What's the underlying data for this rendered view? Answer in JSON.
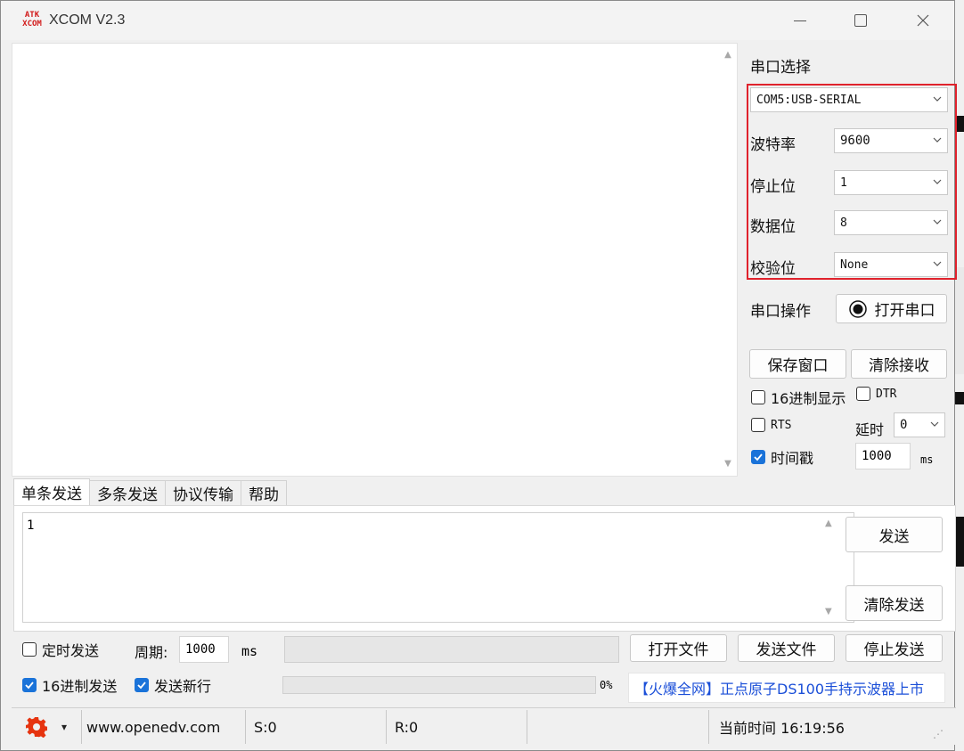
{
  "window": {
    "title": "XCOM V2.3",
    "logo_top": "ATK",
    "logo_bottom": "XCOM"
  },
  "right_panel": {
    "port_section_label": "串口选择",
    "port_value": "COM5:USB-SERIAL",
    "baud_label": "波特率",
    "baud_value": "9600",
    "stop_label": "停止位",
    "stop_value": "1",
    "data_label": "数据位",
    "data_value": "8",
    "parity_label": "校验位",
    "parity_value": "None",
    "op_label": "串口操作",
    "open_port_button": "打开串口",
    "save_window_button": "保存窗口",
    "clear_recv_button": "清除接收",
    "hex_display_label": "16进制显示",
    "hex_display_checked": false,
    "dtr_label": "DTR",
    "dtr_checked": false,
    "rts_label": "RTS",
    "rts_checked": false,
    "delay_label": "延时",
    "delay_value": "0",
    "timestamp_label": "时间戳",
    "timestamp_checked": true,
    "timestamp_value": "1000",
    "timestamp_unit": "ms"
  },
  "tabs": [
    "单条发送",
    "多条发送",
    "协议传输",
    "帮助"
  ],
  "send": {
    "text": "1",
    "send_button": "发送",
    "clear_send_button": "清除发送"
  },
  "bottom": {
    "timed_send_label": "定时发送",
    "timed_send_checked": false,
    "period_label": "周期:",
    "period_value": "1000",
    "period_unit": "ms",
    "open_file_button": "打开文件",
    "send_file_button": "发送文件",
    "stop_send_button": "停止发送",
    "hex_send_label": "16进制发送",
    "hex_send_checked": true,
    "newline_label": "发送新行",
    "newline_checked": true,
    "progress_text": "0%",
    "progress_fraction": 0,
    "ad_text": "【火爆全网】正点原子DS100手持示波器上市"
  },
  "statusbar": {
    "website": "www.openedv.com",
    "sent": "S:0",
    "received": "R:0",
    "time_label": "当前时间 16:19:56"
  },
  "colors": {
    "accent": "#1a73d9",
    "highlight_box": "#e0222c",
    "link": "#1b4fd8",
    "logo": "#d21a1a"
  }
}
